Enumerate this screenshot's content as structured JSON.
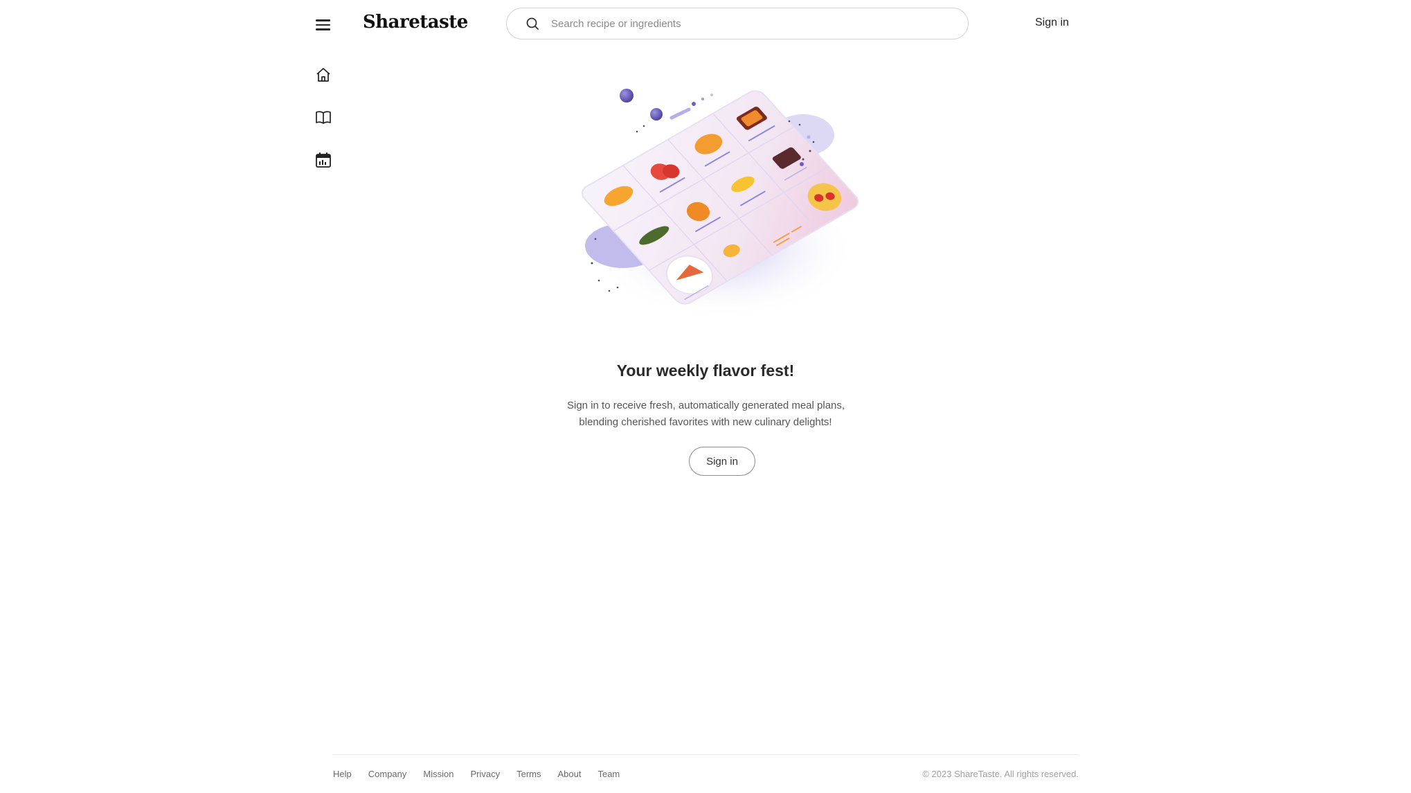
{
  "header": {
    "logo": "Sharetaste",
    "search_placeholder": "Search recipe or ingredients",
    "signin_label": "Sign in",
    "menu_icon": "hamburger-menu-icon",
    "search_icon": "search-icon"
  },
  "sidebar": {
    "items": [
      {
        "icon": "home-icon"
      },
      {
        "icon": "book-icon"
      },
      {
        "icon": "calendar-icon"
      }
    ]
  },
  "main": {
    "illustration": "meal-plan-illustration",
    "title": "Your weekly flavor fest!",
    "description_line1": "Sign in to receive fresh, automatically generated meal plans,",
    "description_line2": "blending cherished favorites with new culinary delights!",
    "signin_button": "Sign in"
  },
  "footer": {
    "links": [
      "Help",
      "Company",
      "Mission",
      "Privacy",
      "Terms",
      "About",
      "Team"
    ],
    "copyright": "© 2023 ShareTaste. All rights reserved."
  },
  "colors": {
    "accent_purple": "#6b5fc7",
    "text_primary": "#2a2a2a",
    "text_secondary": "#555555"
  }
}
